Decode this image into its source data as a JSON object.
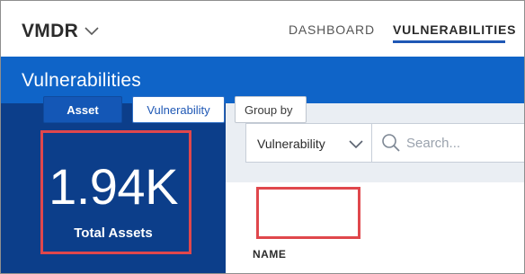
{
  "header": {
    "app_name": "VMDR",
    "nav": {
      "dashboard": "DASHBOARD",
      "vulnerabilities": "VULNERABILITIES"
    }
  },
  "page": {
    "title": "Vulnerabilities"
  },
  "summary": {
    "value": "1.94K",
    "label": "Total Assets"
  },
  "filters": {
    "type_select": "Vulnerability",
    "search_placeholder": "Search..."
  },
  "view_toggle": {
    "asset": "Asset",
    "vulnerability": "Vulnerability",
    "group_by": "Group by"
  },
  "table": {
    "columns": [
      "NAME"
    ]
  },
  "colors": {
    "brand_blue": "#0f64c8",
    "panel_dark": "#0c3e8a",
    "highlight_red": "#e0474c"
  }
}
